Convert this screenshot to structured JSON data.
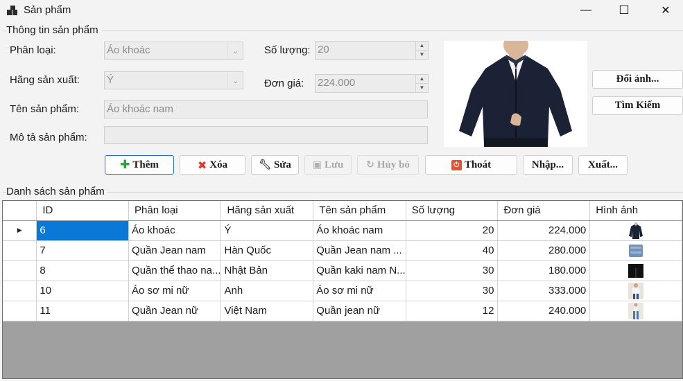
{
  "window": {
    "title": "Sản phẩm",
    "minimize": "—",
    "maximize": "☐",
    "close": "✕"
  },
  "info_group": {
    "title": "Thông tin sản phẩm",
    "category_label": "Phân loại:",
    "category_value": "Áo khoác",
    "manufacturer_label": "Hãng sản xuất:",
    "manufacturer_value": "Ý",
    "name_label": "Tên sản phẩm:",
    "name_value": "Áo khoác nam",
    "description_label": "Mô tả sản phẩm:",
    "description_value": "",
    "quantity_label": "Số lượng:",
    "quantity_value": "20",
    "price_label": "Đơn giá:",
    "price_value": "224.000"
  },
  "image_buttons": {
    "change_image": "Đổi ảnh...",
    "search": "Tìm Kiếm"
  },
  "actions": {
    "add": "Thêm",
    "delete": "Xóa",
    "edit": "Sửa",
    "save": "Lưu",
    "cancel": "Hủy bỏ",
    "exit": "Thoát",
    "import": "Nhập...",
    "export": "Xuất..."
  },
  "list_group": {
    "title": "Danh sách sản phẩm"
  },
  "table": {
    "columns": [
      "ID",
      "Phân loại",
      "Hãng sản xuất",
      "Tên sản phẩm",
      "Số lượng",
      "Đơn giá",
      "Hình ảnh"
    ],
    "rows": [
      {
        "id": "6",
        "category": "Áo khoác",
        "manufacturer": "Ý",
        "name": "Áo khoác nam",
        "quantity": "20",
        "price": "224.000",
        "image": "jacket"
      },
      {
        "id": "7",
        "category": "Quần Jean nam",
        "manufacturer": "Hàn Quốc",
        "name": "Quần Jean nam ...",
        "quantity": "40",
        "price": "280.000",
        "image": "jeans"
      },
      {
        "id": "8",
        "category": "Quần thể thao na...",
        "manufacturer": "Nhật Bản",
        "name": "Quần kaki nam N...",
        "quantity": "30",
        "price": "180.000",
        "image": "pants"
      },
      {
        "id": "10",
        "category": "Áo sơ mi nữ",
        "manufacturer": "Anh",
        "name": "Áo sơ mi nữ",
        "quantity": "30",
        "price": "333.000",
        "image": "shirt"
      },
      {
        "id": "11",
        "category": "Quần Jean nữ",
        "manufacturer": "Việt Nam",
        "name": "Quần jean nữ",
        "quantity": "12",
        "price": "240.000",
        "image": "women-jeans"
      }
    ]
  },
  "colors": {
    "selection": "#0a78d7",
    "focus_border": "#1f6fc9",
    "grid_background": "#a0a0a0"
  }
}
